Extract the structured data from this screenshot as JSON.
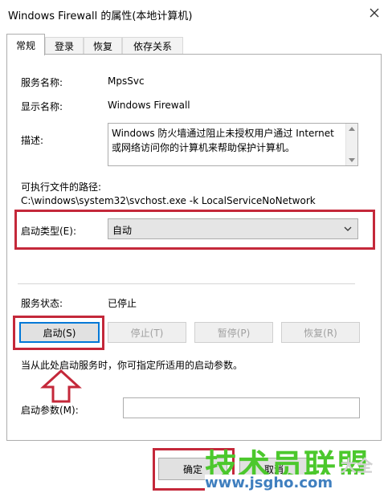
{
  "window": {
    "title": "Windows Firewall 的属性(本地计算机)",
    "close_icon": "close-icon"
  },
  "tabs": [
    {
      "label": "常规"
    },
    {
      "label": "登录"
    },
    {
      "label": "恢复"
    },
    {
      "label": "依存关系"
    }
  ],
  "general": {
    "service_name_label": "服务名称:",
    "service_name_value": "MpsSvc",
    "display_name_label": "显示名称:",
    "display_name_value": "Windows Firewall",
    "description_label": "描述:",
    "description_value": "Windows 防火墙通过阻止未授权用户通过 Internet 或网络访问你的计算机来帮助保护计算机。",
    "exe_path_label": "可执行文件的路径:",
    "exe_path_value": "C:\\windows\\system32\\svchost.exe -k LocalServiceNoNetwork",
    "startup_type_label": "启动类型(E):",
    "startup_type_value": "自动",
    "service_status_label": "服务状态:",
    "service_status_value": "已停止",
    "hint_text": "当从此处启动服务时，你可指定所适用的启动参数。",
    "start_params_label": "启动参数(M):",
    "start_params_value": ""
  },
  "buttons": {
    "start": "启动(S)",
    "stop": "停止(T)",
    "pause": "暂停(P)",
    "resume": "恢复(R)",
    "ok": "确定",
    "cancel": "取消"
  },
  "watermark": {
    "main": "技术员联盟",
    "side": "大全",
    "url": "www.jsgho.com"
  },
  "colors": {
    "highlight_red": "#c4283a",
    "focus_blue": "#0078d7",
    "watermark_green": "#4cc82d"
  }
}
